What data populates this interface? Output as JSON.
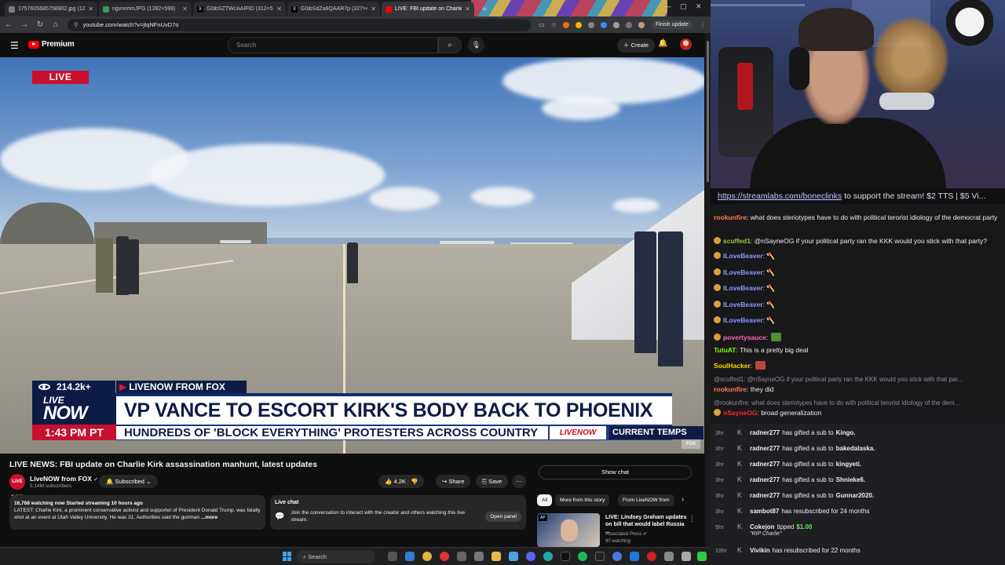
{
  "browser": {
    "tabs": [
      {
        "title": "1757605685758902.jpg (1206×",
        "icon": "image-tab-icon",
        "color": "#7c7c7c",
        "active": false
      },
      {
        "title": "ngvnnhmJPG (1392×599)",
        "icon": "image-tab-icon",
        "color": "#3a9b5d",
        "active": false
      },
      {
        "title": "G0ibSZTWcAAIFID (312×588)",
        "icon": "x-tab-icon",
        "color": "#000000",
        "active": false
      },
      {
        "title": "G0ibSdZa8QAAR7p (327×461)",
        "icon": "x-tab-icon",
        "color": "#000000",
        "active": false
      },
      {
        "title": "LIVE: FBI update on Charlie",
        "icon": "youtube-tab-icon",
        "color": "#ff0000",
        "active": true
      }
    ],
    "url": "youtube.com/watch?v=jtqNFnUvD7o",
    "finish_update": "Finish update"
  },
  "youtube": {
    "logo_text": "Premium",
    "search_placeholder": "Search",
    "create_label": "Create",
    "video": {
      "live_badge": "LIVE",
      "viewers": "214.2k+",
      "channel_tag": "LIVENOW FROM FOX",
      "live_now_line1": "LIVE",
      "live_now_line2": "NOW",
      "headline": "VP VANCE TO ESCORT KIRK'S BODY BACK TO PHOENIX",
      "time": "1:43 PM PT",
      "ticker": "HUNDREDS OF 'BLOCK EVERYTHING' PROTESTERS ACROSS COUNTRY",
      "ticker_logo": "LIVENOW",
      "ticker_right": "CURRENT TEMPS",
      "bug": "FOX"
    },
    "title": "LIVE NEWS: FBI update on Charlie Kirk assassination manhunt, latest updates",
    "channel": {
      "name": "LiveNOW from FOX",
      "avatar_text": "LIVE NOW",
      "subscribers": "5.14M subscribers",
      "subscribed_label": "Subscribed"
    },
    "actions": {
      "likes": "4.2K",
      "share": "Share",
      "save": "Save"
    },
    "description": {
      "stats": "16,768 watching now  Started streaming 10 hours ago",
      "text": "LATEST: Charlie Kirk, a prominent conservative activist and supporter of President Donald Trump, was fatally shot at an event at Utah Valley University. He was 31. Authorities said the gunman",
      "more": "...more"
    },
    "live_chat_card": {
      "title": "Live chat",
      "text": "Join the conversation to interact with the creator and others watching this live stream.",
      "button": "Open panel"
    },
    "show_chat": "Show chat",
    "chips": [
      "All",
      "More from this story",
      "From LiveNOW from"
    ],
    "recommended": {
      "title": "LIVE: Lindsey Graham updates on bill that would label Russia ...",
      "channel": "Associated Press",
      "watching": "90 watching",
      "thumb_tag": "AP"
    }
  },
  "stream_chat": {
    "top_line_link": "https://streamlabs.com/boneclinks",
    "top_line_rest": " to support the stream! $2 TTS | $5 Vi...",
    "messages": [
      {
        "user": "rookunfire",
        "color": "#ff7f50",
        "text": " what does steriotypes have to do with political terorist idiology of the democrat party"
      },
      {
        "user": "scuffed1",
        "color": "#9acd32",
        "text": " @nSayneOG if your political party ran the KKK would you stick with that party?"
      },
      {
        "user": "ILoveBeaver",
        "color": "#8a9cff",
        "text": " 🪓"
      },
      {
        "user": "ILoveBeaver",
        "color": "#8a9cff",
        "text": " 🪓"
      },
      {
        "user": "ILoveBeaver",
        "color": "#8a9cff",
        "text": " 🪓"
      },
      {
        "user": "ILoveBeaver",
        "color": "#8a9cff",
        "text": " 🪓"
      },
      {
        "user": "ILoveBeaver",
        "color": "#8a9cff",
        "text": " 🪓"
      },
      {
        "user": "povertysauce",
        "color": "#ff69b4",
        "text": ""
      },
      {
        "user": "TutuAT",
        "color": "#7fff00",
        "text": " This is a pretty big deal"
      },
      {
        "user": "SoulHacker",
        "color": "#ffd700",
        "text": ""
      },
      {
        "user": "",
        "color": "#8d8d95",
        "text": "@scuffed1: @nSayneOG if your political party ran the KKK would you stick with that par..."
      },
      {
        "user": "rookunfire",
        "color": "#ff7f50",
        "text": " they did"
      },
      {
        "user": "",
        "color": "#8d8d95",
        "text": "@rookunfire: what does steriotypes have to do with political terorist idiology of the dem..."
      },
      {
        "user": "nSayneOG",
        "color": "#ff2a2a",
        "text": " broad generalization"
      }
    ],
    "events": [
      {
        "time": "3hr",
        "user": "radner277",
        "text": "has gifted a sub to",
        "target": "Kingo."
      },
      {
        "time": "3hr",
        "user": "radner277",
        "text": "has gifted a sub to",
        "target": "bakedalaska."
      },
      {
        "time": "3hr",
        "user": "radner277",
        "text": "has gifted a sub to",
        "target": "kingyeti."
      },
      {
        "time": "3hr",
        "user": "radner277",
        "text": "has gifted a sub to",
        "target": "Shnieke6."
      },
      {
        "time": "3hr",
        "user": "radner277",
        "text": "has gifted a sub to",
        "target": "Gunnar2020."
      },
      {
        "time": "3hr",
        "user": "sambot87",
        "text": "has resubscribed for 24 months",
        "target": ""
      },
      {
        "time": "5hr",
        "user": "Cokejon",
        "text": "tipped",
        "target": "$1.00",
        "note": "\"RIP Charlie\""
      },
      {
        "time": "19hr",
        "user": "Vivikin",
        "text": "has resubscribed for 22 months",
        "target": ""
      }
    ]
  },
  "taskbar": {
    "search_placeholder": "Search"
  }
}
